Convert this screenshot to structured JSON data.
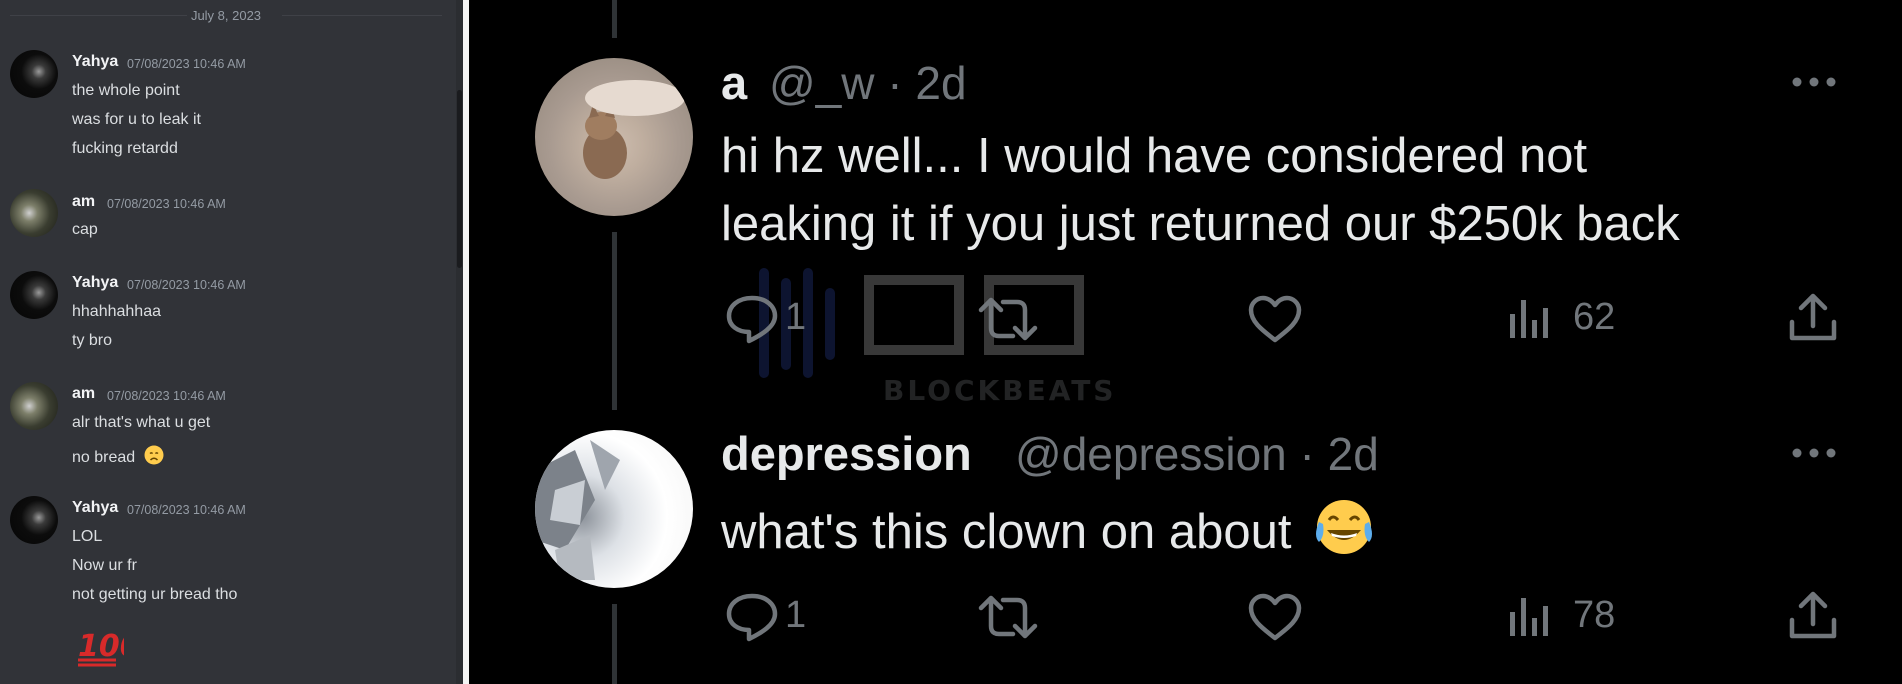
{
  "discord": {
    "date_divider": "July 8, 2023",
    "messages": [
      {
        "author": "Yahya",
        "timestamp": "07/08/2023 10:46 AM",
        "lines": [
          "the whole point",
          "was for u to leak it",
          "fucking retardd"
        ]
      },
      {
        "author": "am",
        "timestamp": "07/08/2023 10:46 AM",
        "lines": [
          "cap"
        ]
      },
      {
        "author": "Yahya",
        "timestamp": "07/08/2023 10:46 AM",
        "lines": [
          "hhahhahhaa",
          "ty bro"
        ]
      },
      {
        "author": "am",
        "timestamp": "07/08/2023 10:46 AM",
        "lines": [
          "alr that's what u get",
          "no bread"
        ]
      },
      {
        "author": "Yahya",
        "timestamp": "07/08/2023 10:46 AM",
        "lines": [
          "LOL",
          "Now ur fr",
          "not getting ur bread tho"
        ]
      }
    ],
    "emoji_icons": [
      "disappointed-face-icon",
      "hundred-points-icon"
    ]
  },
  "twitter": {
    "tweets": [
      {
        "display_name": "a",
        "handle": "@_w",
        "age": "· 2d",
        "text_lines": [
          "hi hz well... I would have considered not",
          "leaking it if you just returned our $250k back"
        ],
        "replies": "1",
        "views": "62"
      },
      {
        "display_name": "depression",
        "handle": "@depression",
        "age": "· 2d",
        "text_lines": [
          "what's this clown on about"
        ],
        "replies": "1",
        "views": "78"
      }
    ],
    "watermark": "BLOCKBEATS",
    "colors": {
      "text": "#e7e9ea",
      "muted": "#71767b",
      "background": "#000000"
    }
  }
}
